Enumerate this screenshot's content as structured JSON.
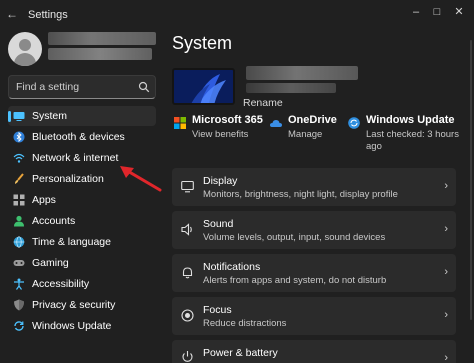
{
  "window": {
    "title": "Settings",
    "back_icon": "back-arrow-icon",
    "controls": [
      "minimize",
      "maximize",
      "close"
    ]
  },
  "sidebar": {
    "search_placeholder": "Find a setting",
    "items": [
      {
        "label": "System",
        "icon": "system-icon",
        "selected": true
      },
      {
        "label": "Bluetooth & devices",
        "icon": "bluetooth-icon"
      },
      {
        "label": "Network & internet",
        "icon": "wifi-icon"
      },
      {
        "label": "Personalization",
        "icon": "brush-icon"
      },
      {
        "label": "Apps",
        "icon": "apps-icon"
      },
      {
        "label": "Accounts",
        "icon": "accounts-icon"
      },
      {
        "label": "Time & language",
        "icon": "globe-clock-icon"
      },
      {
        "label": "Gaming",
        "icon": "gamepad-icon"
      },
      {
        "label": "Accessibility",
        "icon": "accessibility-icon"
      },
      {
        "label": "Privacy & security",
        "icon": "shield-icon"
      },
      {
        "label": "Windows Update",
        "icon": "update-icon"
      }
    ]
  },
  "main": {
    "title": "System",
    "rename": "Rename",
    "status": [
      {
        "title": "Microsoft 365",
        "sub": "View benefits",
        "icon": "microsoft-365-icon"
      },
      {
        "title": "OneDrive",
        "sub": "Manage",
        "icon": "onedrive-icon"
      },
      {
        "title": "Windows Update",
        "sub_line1": "Last checked: 3 hours",
        "sub_line2": "ago",
        "icon": "windows-update-icon"
      }
    ],
    "cards": [
      {
        "title": "Display",
        "sub": "Monitors, brightness, night light, display profile",
        "icon": "display-icon"
      },
      {
        "title": "Sound",
        "sub": "Volume levels, output, input, sound devices",
        "icon": "sound-icon"
      },
      {
        "title": "Notifications",
        "sub": "Alerts from apps and system, do not disturb",
        "icon": "bell-icon"
      },
      {
        "title": "Focus",
        "sub": "Reduce distractions",
        "icon": "focus-icon"
      },
      {
        "title": "Power & battery",
        "sub": "",
        "icon": "power-icon"
      }
    ]
  },
  "colors": {
    "background": "#202020",
    "card": "#2b2b2b",
    "accent": "#4cc2ff",
    "annotation_arrow": "#e0262b"
  }
}
